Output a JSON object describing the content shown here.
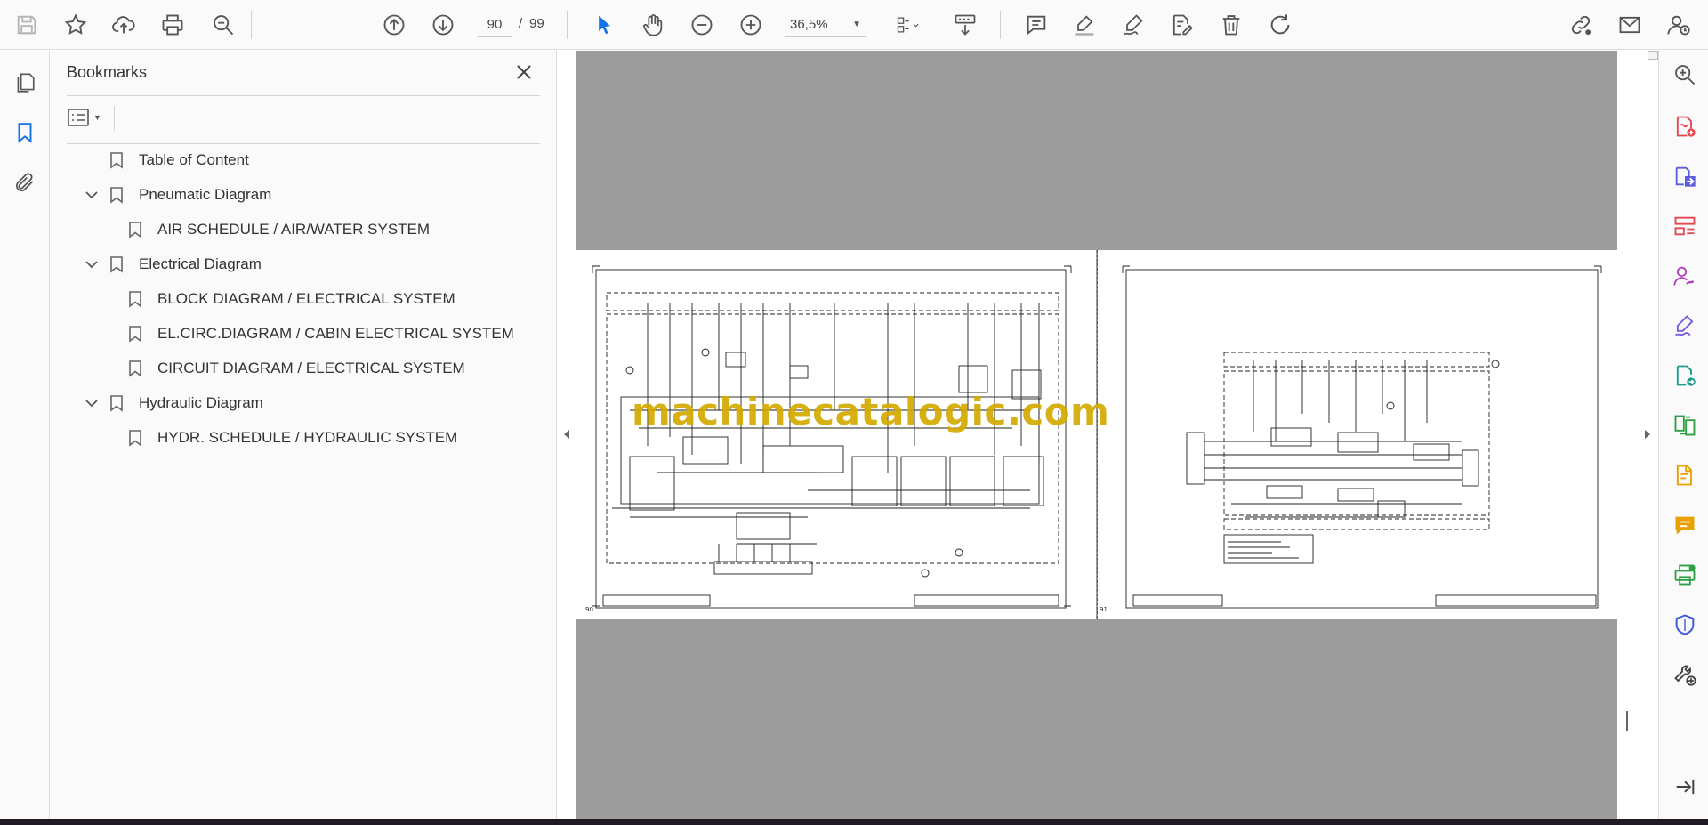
{
  "toolbar": {
    "current_page": "90",
    "page_separator": "/",
    "total_pages": "99",
    "zoom_level": "36,5%",
    "tools": [
      "save-icon",
      "star-icon",
      "upload-icon",
      "print-icon",
      "zoom-search-icon",
      "page-up-icon",
      "page-down-icon",
      "select-cursor-icon",
      "hand-icon",
      "zoom-out-icon",
      "zoom-in-icon",
      "page-fit-icon",
      "scroll-mode-icon",
      "comment-icon",
      "highlight-icon",
      "draw-icon",
      "edit-text-icon",
      "delete-icon",
      "rotate-icon",
      "share-link-icon",
      "email-icon",
      "account-icon"
    ]
  },
  "bookmarks_panel": {
    "title": "Bookmarks",
    "items": [
      {
        "label": "Table of Content",
        "level": 0,
        "expandable": false
      },
      {
        "label": "Pneumatic Diagram",
        "level": 0,
        "expandable": true
      },
      {
        "label": "AIR SCHEDULE / AIR/WATER SYSTEM",
        "level": 1,
        "expandable": false
      },
      {
        "label": "Electrical Diagram",
        "level": 0,
        "expandable": true
      },
      {
        "label": "BLOCK DIAGRAM / ELECTRICAL SYSTEM",
        "level": 1,
        "expandable": false
      },
      {
        "label": "EL.CIRC.DIAGRAM / CABIN ELECTRICAL SYSTEM",
        "level": 1,
        "expandable": false
      },
      {
        "label": "CIRCUIT DIAGRAM / ELECTRICAL SYSTEM",
        "level": 1,
        "expandable": false
      },
      {
        "label": "Hydraulic Diagram",
        "level": 0,
        "expandable": true
      },
      {
        "label": "HYDR. SCHEDULE / HYDRAULIC SYSTEM",
        "level": 1,
        "expandable": false
      }
    ]
  },
  "document": {
    "watermark": "machinecatalogic.com",
    "left_page_number": "90",
    "right_page_number": "91"
  },
  "colors": {
    "accent_blue": "#1473e6",
    "watermark_gold": "#d4aa00",
    "canvas_gray": "#9c9c9c"
  }
}
